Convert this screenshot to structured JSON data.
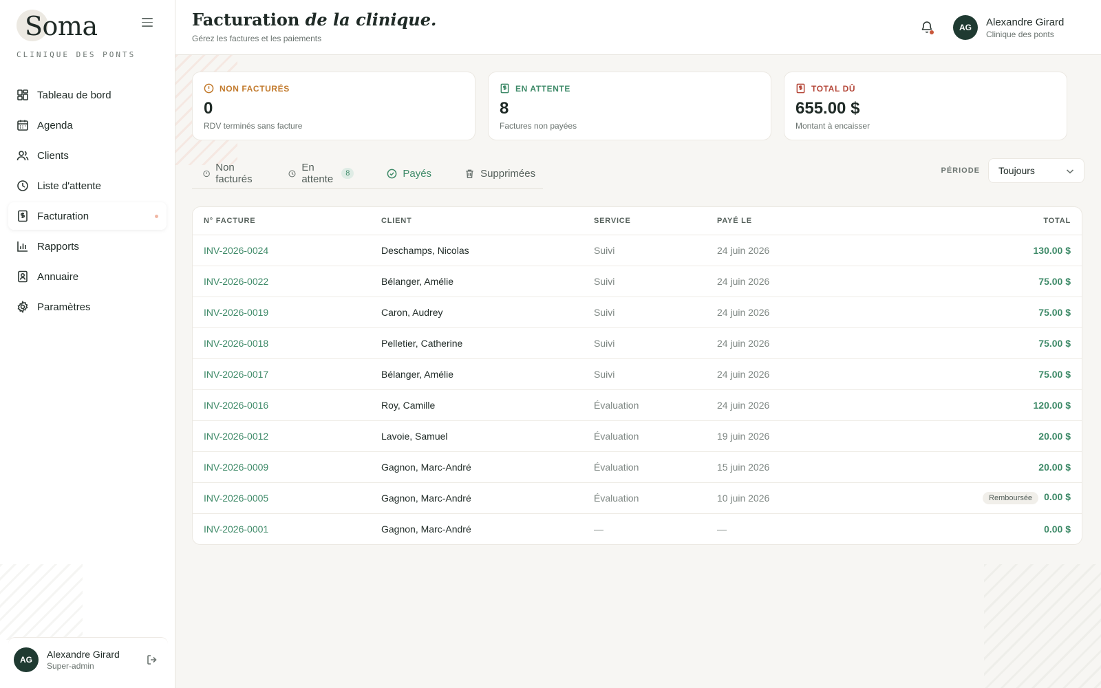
{
  "brand": {
    "name": "Soma",
    "subtitle": "CLINIQUE DES PONTS"
  },
  "nav": [
    {
      "label": "Tableau de bord",
      "icon": "dashboard-icon"
    },
    {
      "label": "Agenda",
      "icon": "calendar-icon"
    },
    {
      "label": "Clients",
      "icon": "users-icon"
    },
    {
      "label": "Liste d'attente",
      "icon": "clock-icon"
    },
    {
      "label": "Facturation",
      "icon": "invoice-icon",
      "active": true
    },
    {
      "label": "Rapports",
      "icon": "bar-chart-icon"
    },
    {
      "label": "Annuaire",
      "icon": "contact-book-icon"
    },
    {
      "label": "Paramètres",
      "icon": "gear-icon"
    }
  ],
  "sidebar_user": {
    "initials": "AG",
    "name": "Alexandre Girard",
    "role": "Super-admin"
  },
  "header": {
    "title_main": "Facturation ",
    "title_em": "de la clinique.",
    "subtitle": "Gérez les factures et les paiements",
    "user": {
      "initials": "AG",
      "name": "Alexandre Girard",
      "org": "Clinique des ponts"
    }
  },
  "stats": [
    {
      "label": "NON FACTURÉS",
      "value": "0",
      "desc": "RDV terminés sans facture",
      "color": "#c27a2c",
      "icon": "alert-circle-icon"
    },
    {
      "label": "EN ATTENTE",
      "value": "8",
      "desc": "Factures non payées",
      "color": "#3e8a68",
      "icon": "receipt-icon"
    },
    {
      "label": "TOTAL DÛ",
      "value": "655.00 $",
      "desc": "Montant à encaisser",
      "color": "#b5483a",
      "icon": "dollar-doc-icon"
    }
  ],
  "tabs": [
    {
      "label": "Non facturés",
      "icon": "alert-circle-icon"
    },
    {
      "label": "En attente",
      "icon": "clock-icon",
      "badge": "8"
    },
    {
      "label": "Payés",
      "icon": "check-circle-icon",
      "active": true
    },
    {
      "label": "Supprimées",
      "icon": "trash-icon"
    }
  ],
  "period": {
    "label": "PÉRIODE",
    "value": "Toujours"
  },
  "table": {
    "columns": [
      "N° FACTURE",
      "CLIENT",
      "SERVICE",
      "PAYÉ LE",
      "TOTAL"
    ],
    "rows": [
      {
        "invoice": "INV-2026-0024",
        "client": "Deschamps, Nicolas",
        "service": "Suivi",
        "paid": "24 juin 2026",
        "total": "130.00 $"
      },
      {
        "invoice": "INV-2026-0022",
        "client": "Bélanger, Amélie",
        "service": "Suivi",
        "paid": "24 juin 2026",
        "total": "75.00 $"
      },
      {
        "invoice": "INV-2026-0019",
        "client": "Caron, Audrey",
        "service": "Suivi",
        "paid": "24 juin 2026",
        "total": "75.00 $"
      },
      {
        "invoice": "INV-2026-0018",
        "client": "Pelletier, Catherine",
        "service": "Suivi",
        "paid": "24 juin 2026",
        "total": "75.00 $"
      },
      {
        "invoice": "INV-2026-0017",
        "client": "Bélanger, Amélie",
        "service": "Suivi",
        "paid": "24 juin 2026",
        "total": "75.00 $"
      },
      {
        "invoice": "INV-2026-0016",
        "client": "Roy, Camille",
        "service": "Évaluation",
        "paid": "24 juin 2026",
        "total": "120.00 $"
      },
      {
        "invoice": "INV-2026-0012",
        "client": "Lavoie, Samuel",
        "service": "Évaluation",
        "paid": "19 juin 2026",
        "total": "20.00 $"
      },
      {
        "invoice": "INV-2026-0009",
        "client": "Gagnon, Marc-André",
        "service": "Évaluation",
        "paid": "15 juin 2026",
        "total": "20.00 $"
      },
      {
        "invoice": "INV-2026-0005",
        "client": "Gagnon, Marc-André",
        "service": "Évaluation",
        "paid": "10 juin 2026",
        "total": "0.00 $",
        "badge": "Remboursée"
      },
      {
        "invoice": "INV-2026-0001",
        "client": "Gagnon, Marc-André",
        "service": "—",
        "paid": "—",
        "total": "0.00 $"
      }
    ]
  }
}
